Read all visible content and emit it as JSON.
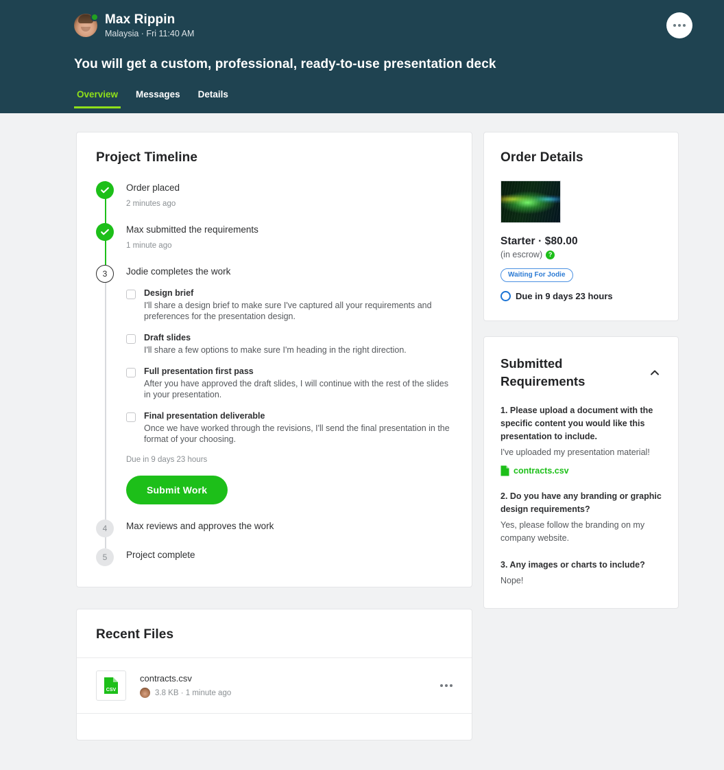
{
  "colors": {
    "header_bg": "#1f4351",
    "accent_green": "#1dbf19",
    "tab_active": "#8fe01a",
    "badge_blue": "#2c7bd4"
  },
  "header": {
    "user_name": "Max Rippin",
    "user_sub": "Malaysia · Fri 11:40 AM",
    "gig_title": "You will get a custom, professional, ready-to-use presentation deck",
    "tabs": [
      {
        "label": "Overview",
        "active": true
      },
      {
        "label": "Messages",
        "active": false
      },
      {
        "label": "Details",
        "active": false
      }
    ]
  },
  "timeline": {
    "title": "Project Timeline",
    "steps": [
      {
        "marker": "check",
        "state": "done",
        "title": "Order placed",
        "time": "2 minutes ago"
      },
      {
        "marker": "check",
        "state": "done",
        "title": "Max submitted the requirements",
        "time": "1 minute ago"
      },
      {
        "marker": "3",
        "state": "current",
        "title": "Jodie completes the work",
        "time": ""
      },
      {
        "marker": "4",
        "state": "todo",
        "title": "Max reviews and approves the work",
        "time": ""
      },
      {
        "marker": "5",
        "state": "todo",
        "title": "Project complete",
        "time": ""
      }
    ],
    "checklist": [
      {
        "label": "Design brief",
        "desc": "I'll share a design brief to make sure I've captured all your requirements and preferences for the presentation design.",
        "checked": false
      },
      {
        "label": "Draft slides",
        "desc": "I'll share a few options to make sure I'm heading in the right direction.",
        "checked": false
      },
      {
        "label": "Full presentation first pass",
        "desc": "After you have approved the draft slides, I will continue with the rest of the slides in your presentation.",
        "checked": false
      },
      {
        "label": "Final presentation deliverable",
        "desc": "Once we have worked through the revisions, I'll send the final presentation in the format of your choosing.",
        "checked": false
      }
    ],
    "due_note": "Due in 9 days 23 hours",
    "submit_label": "Submit Work"
  },
  "order": {
    "title": "Order Details",
    "price": "Starter · $80.00",
    "escrow": "(in escrow)",
    "help_glyph": "?",
    "status_badge": "Waiting For Jodie",
    "due": "Due in 9 days 23 hours"
  },
  "requirements": {
    "title": "Submitted Requirements",
    "items": [
      {
        "question": "1. Please upload a document with the specific content you would like this presentation to include.",
        "answer": "I've uploaded my presentation material!",
        "file": "contracts.csv"
      },
      {
        "question": "2. Do you have any branding or graphic design requirements?",
        "answer": "Yes, please follow the branding on my company website.",
        "file": ""
      },
      {
        "question": "3. Any images or charts to include?",
        "answer": "Nope!",
        "file": ""
      }
    ]
  },
  "files": {
    "title": "Recent Files",
    "rows": [
      {
        "name": "contracts.csv",
        "meta": "3.8 KB · 1 minute ago",
        "type": "CSV"
      }
    ]
  }
}
